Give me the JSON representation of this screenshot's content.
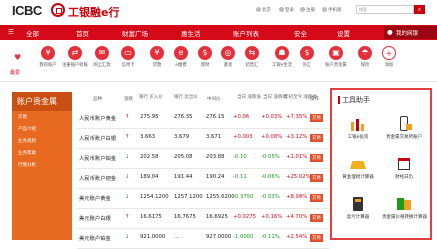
{
  "header": {
    "logo_en": "ICBC",
    "logo_cn": "工银融e行",
    "links": [
      "北京",
      "登录",
      "注册",
      "手机版"
    ],
    "search_placeholder": "搜索",
    "search_icon": "magnifier-icon"
  },
  "nav": {
    "items": [
      "全部",
      "首页",
      "财富广场",
      "惠生活",
      "账户列表",
      "安全",
      "设置"
    ],
    "my_net": "我的网银"
  },
  "icons": {
    "favorite_label": "最爱",
    "items": [
      {
        "label": "我的账户",
        "icon": "account-icon"
      },
      {
        "label": "注册账户转账",
        "icon": "transfer-icon"
      },
      {
        "label": "网上汇款",
        "icon": "remit-icon"
      },
      {
        "label": "信用卡",
        "icon": "credit-card-icon"
      },
      {
        "label": "贷款",
        "icon": "loan-icon"
      },
      {
        "label": "e缴费",
        "icon": "payment-icon"
      },
      {
        "label": "理财",
        "icon": "wealth-icon"
      },
      {
        "label": "基金",
        "icon": "fund-icon"
      },
      {
        "label": "结售汇",
        "icon": "exchange-icon"
      },
      {
        "label": "工银e生活",
        "icon": "life-icon"
      },
      {
        "label": "外汇",
        "icon": "forex-icon"
      },
      {
        "label": "账户贵金属",
        "icon": "metal-icon"
      },
      {
        "label": "保险",
        "icon": "insurance-icon"
      },
      {
        "label": "添加",
        "icon": "add-icon"
      }
    ]
  },
  "sidebar": {
    "title": "账户贵金属",
    "items": [
      "交易",
      "产品介绍",
      "业务规则",
      "业务帮助",
      "行情分析"
    ]
  },
  "table": {
    "headers": [
      "品种",
      "涨跌",
      "银行\n买入价",
      "银行\n卖出价",
      "中间价",
      "当日\n涨跌值",
      "当日\n涨跌幅",
      "年初至今\n涨跌幅",
      "操作"
    ],
    "rows": [
      {
        "name": "人民币账户黄金",
        "buy": "275.95",
        "sell": "276.35",
        "mid": "276.15",
        "chg": "+0.06",
        "pct": "+0.03%",
        "ytd": "+7.35%",
        "up": true,
        "ytd_up": true
      },
      {
        "name": "人民币账户白银",
        "buy": "3.663",
        "sell": "3.679",
        "mid": "3.671",
        "chg": "+0.003",
        "pct": "+0.08%",
        "ytd": "+3.12%",
        "up": true,
        "ytd_up": true
      },
      {
        "name": "人民币账户铂金",
        "buy": "202.58",
        "sell": "205.08",
        "mid": "203.88",
        "chg": "-0.10",
        "pct": "-0.05%",
        "ytd": "+1.01%",
        "up": false,
        "ytd_up": true
      },
      {
        "name": "人民币账户钯金",
        "buy": "189.04",
        "sell": "191.44",
        "mid": "190.24",
        "chg": "-0.11",
        "pct": "-0.06%",
        "ytd": "+25.02%",
        "up": false,
        "ytd_up": true
      },
      {
        "name": "美元账户黄金",
        "buy": "1254.1200",
        "sell": "1257.1200",
        "mid": "1255.6200",
        "chg": "-0.3750",
        "pct": "-0.03%",
        "ytd": "+8.99%",
        "up": false,
        "ytd_up": true
      },
      {
        "name": "美元账户白银",
        "buy": "16.6175",
        "sell": "16.7675",
        "mid": "16.6925",
        "chg": "+0.0275",
        "pct": "+0.16%",
        "ytd": "+4.70%",
        "up": true,
        "ytd_up": true
      },
      {
        "name": "美元账户铂金",
        "buy": "921.0000",
        "sell": "...",
        "mid": "927.0000",
        "chg": "-1.0000",
        "pct": "-0.11%",
        "ytd": "+2.54%",
        "up": false,
        "ytd_up": true
      }
    ],
    "buy_label": "交易"
  },
  "tools": {
    "title": "工具助手",
    "items": [
      "工银e投资",
      "贵金属交易所账户",
      "黄金理财计算器",
      "财经日历",
      "盈亏计算器",
      "贵金属价格转换计算器"
    ]
  },
  "colors": {
    "brand_red": "#d40a19",
    "sidebar_orange": "#e86a20",
    "up": "#d40a19",
    "down": "#1a9d1a"
  }
}
